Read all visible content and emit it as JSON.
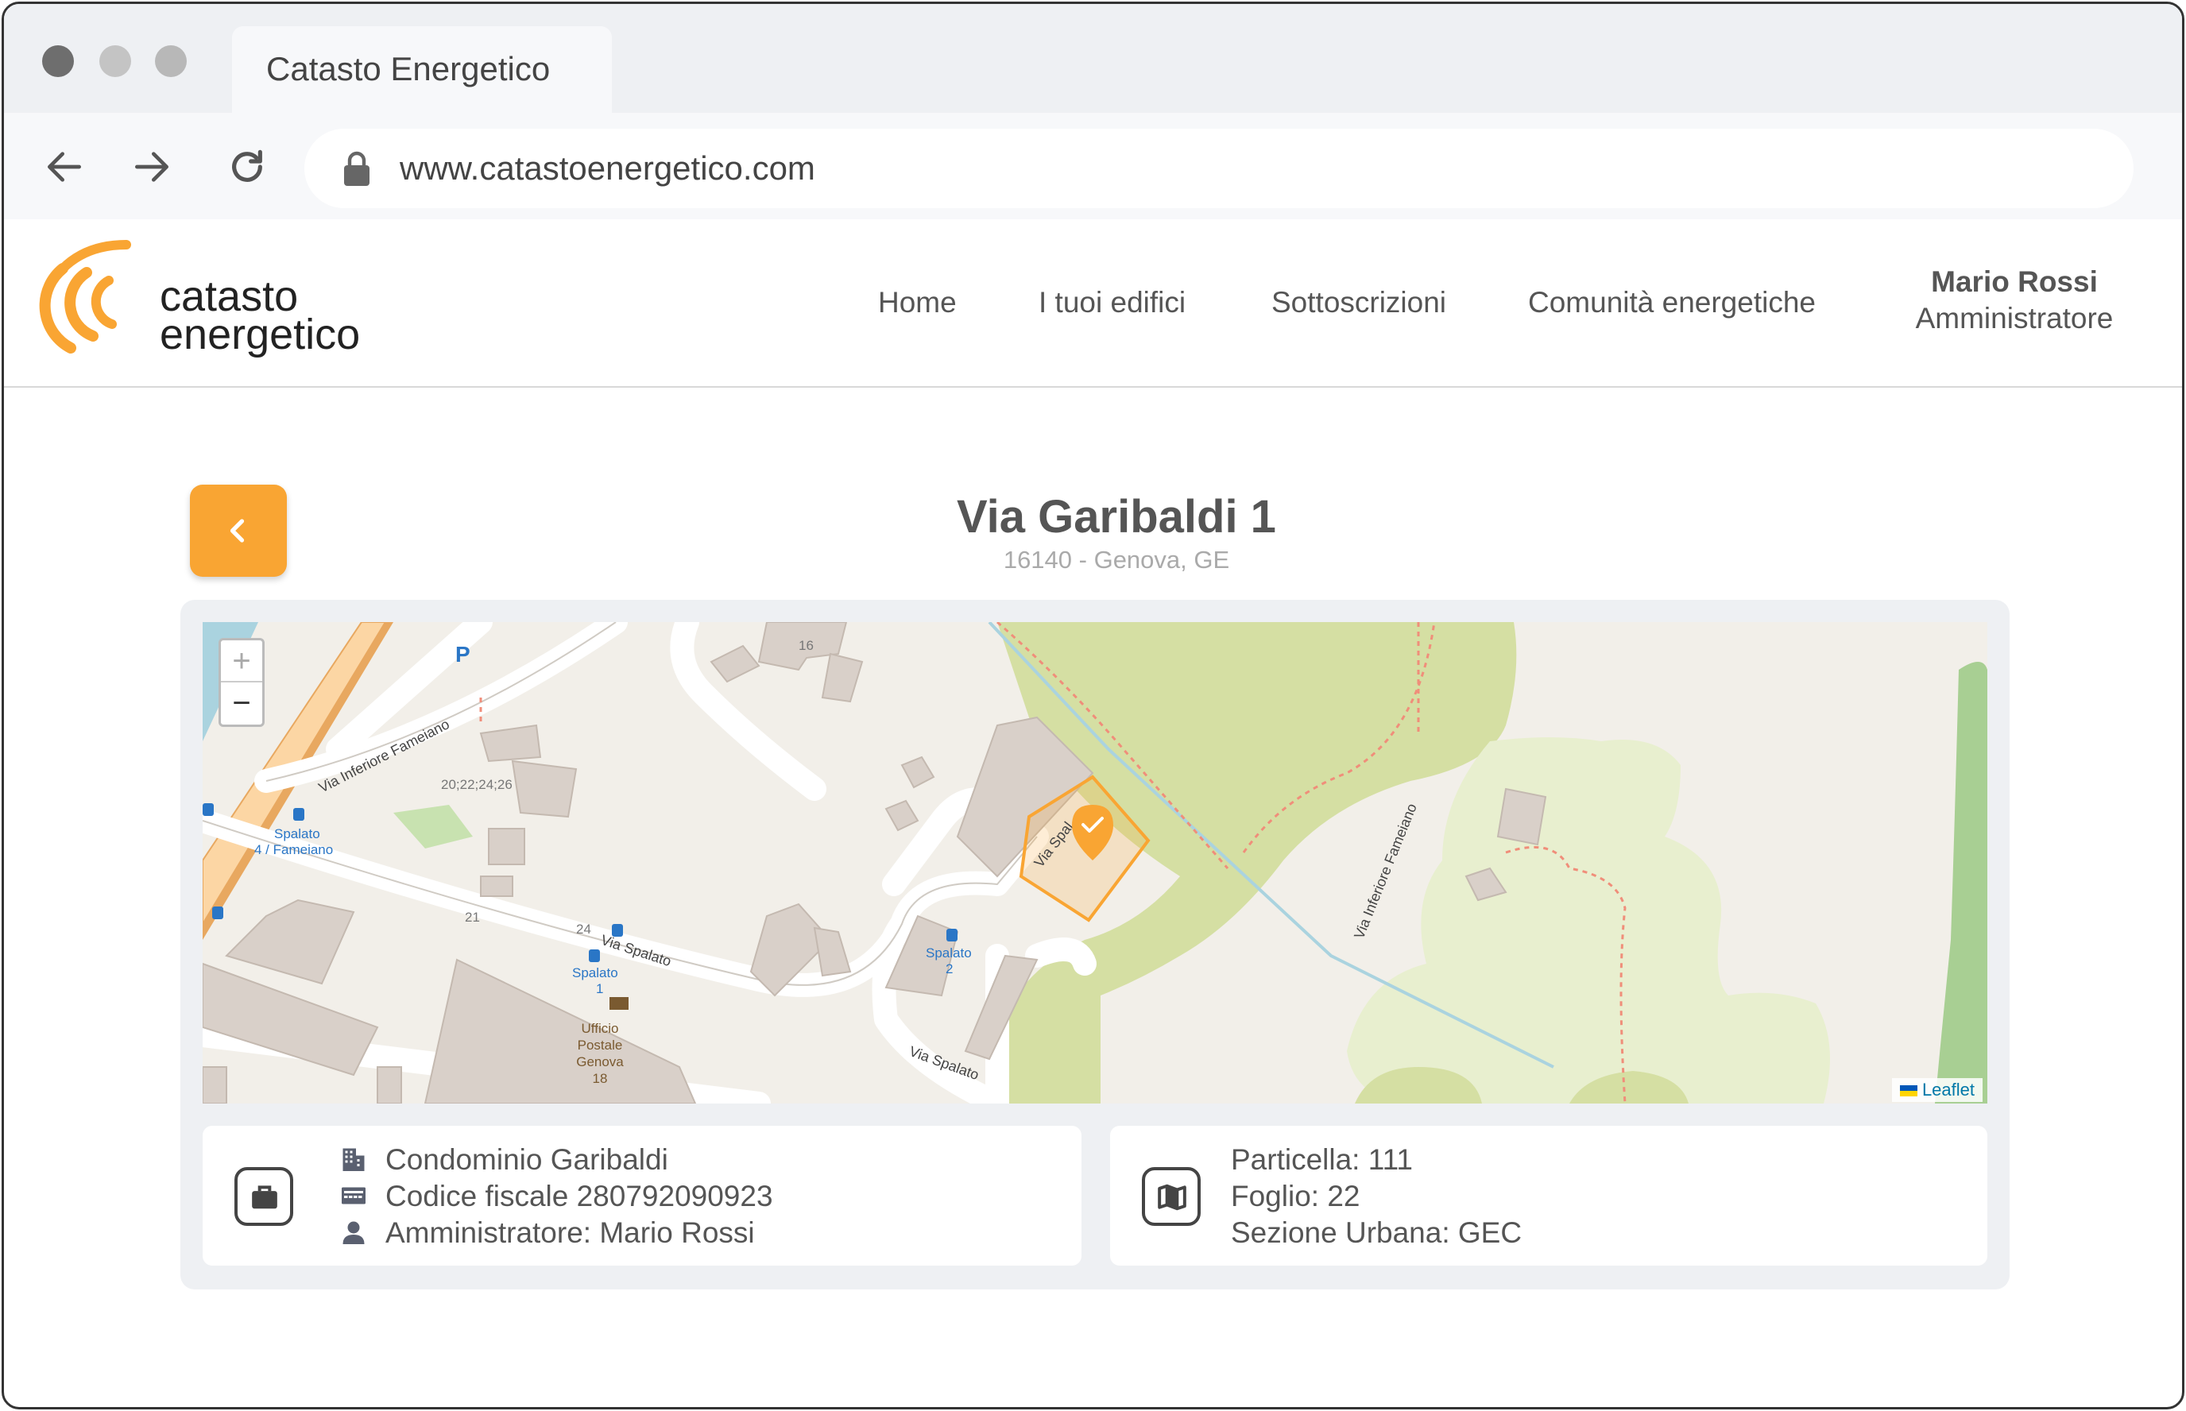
{
  "browser": {
    "tab_title": "Catasto Energetico",
    "url": "www.catastoenergetico.com"
  },
  "header": {
    "logo_line1": "catasto",
    "logo_line2": "energetico",
    "nav": [
      "Home",
      "I tuoi edifici",
      "Sottoscrizioni",
      "Comunità energetiche"
    ],
    "user_name": "Mario Rossi",
    "user_role": "Amministratore"
  },
  "page": {
    "title": "Via Garibaldi 1",
    "subtitle": "16140 - Genova, GE"
  },
  "map": {
    "zoom_in": "+",
    "zoom_out": "−",
    "attribution": "Leaflet",
    "labels": {
      "street_1": "Via Inferiore Fameiano",
      "street_2": "Via Spalato",
      "street_3": "Via Spalato",
      "street_4": "Via Spal",
      "street_5": "Via Inferiore Fameiano",
      "stop_1a": "Spalato",
      "stop_1b": "4 / Fameiano",
      "stop_2a": "Spalato",
      "stop_2b": "1",
      "stop_3a": "Spalato",
      "stop_3b": "2",
      "post_1": "Ufficio",
      "post_2": "Postale",
      "post_3": "Genova",
      "post_4": "18",
      "num_1": "16",
      "num_2": "20;22;24;26",
      "num_3": "21",
      "num_4": "24",
      "parking": "P"
    },
    "colors": {
      "background": "#f2efe9",
      "building": "#d9d0c9",
      "park": "#d5dfa3",
      "forest": "#e8efcf",
      "water": "#aad3df",
      "highway": "#fcd6a4",
      "marker": "#f9a533"
    }
  },
  "card_left": {
    "icon": "briefcase-icon",
    "name": "Condominio Garibaldi",
    "fiscal_code": "Codice fiscale 280792090923",
    "admin": "Amministratore: Mario Rossi"
  },
  "card_right": {
    "icon": "map-icon",
    "particella": "Particella: 111",
    "foglio": "Foglio: 22",
    "sezione": "Sezione Urbana: GEC"
  },
  "accent_color": "#f9a533"
}
